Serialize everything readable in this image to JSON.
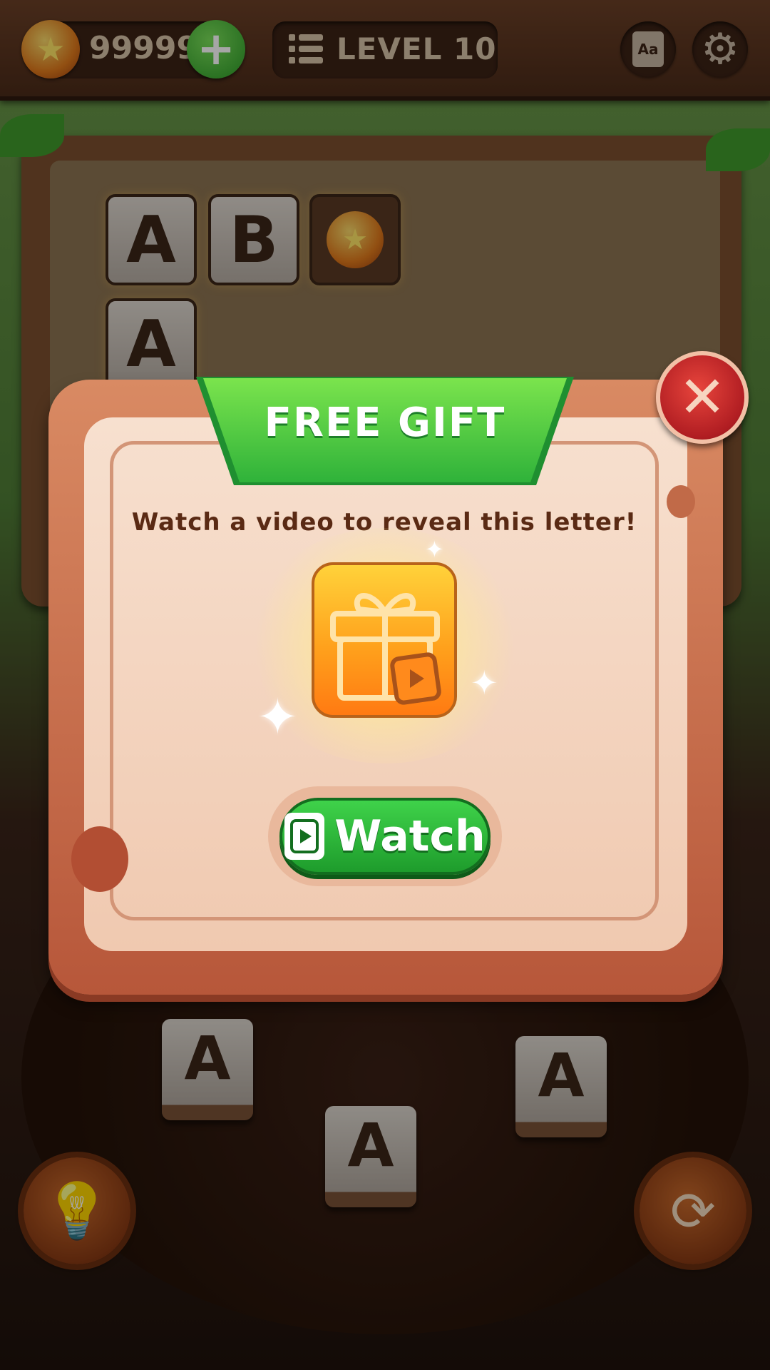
{
  "hud": {
    "coins": "99999",
    "level_label": "LEVEL 10",
    "dictionary_label": "Aa"
  },
  "board": {
    "row1": [
      "A",
      "B"
    ],
    "row2": [
      "A"
    ]
  },
  "letter_wheel": [
    "A",
    "A",
    "A"
  ],
  "dialog": {
    "title": "FREE GIFT",
    "message": "Watch a video to reveal this letter!",
    "button_label": "Watch"
  },
  "icons": {
    "coin": "star-coin-icon",
    "add": "plus-icon",
    "level": "list-icon",
    "dictionary": "dictionary-icon",
    "settings": "gear-icon",
    "hint": "lightbulb-icon",
    "shuffle": "shuffle-icon",
    "close": "close-icon",
    "gift": "gift-video-icon",
    "video": "video-icon"
  },
  "colors": {
    "accent_green": "#2fb23a",
    "close_red": "#b01d22",
    "dialog_frame": "#b7573a",
    "gift_orange": "#ffa11c"
  }
}
